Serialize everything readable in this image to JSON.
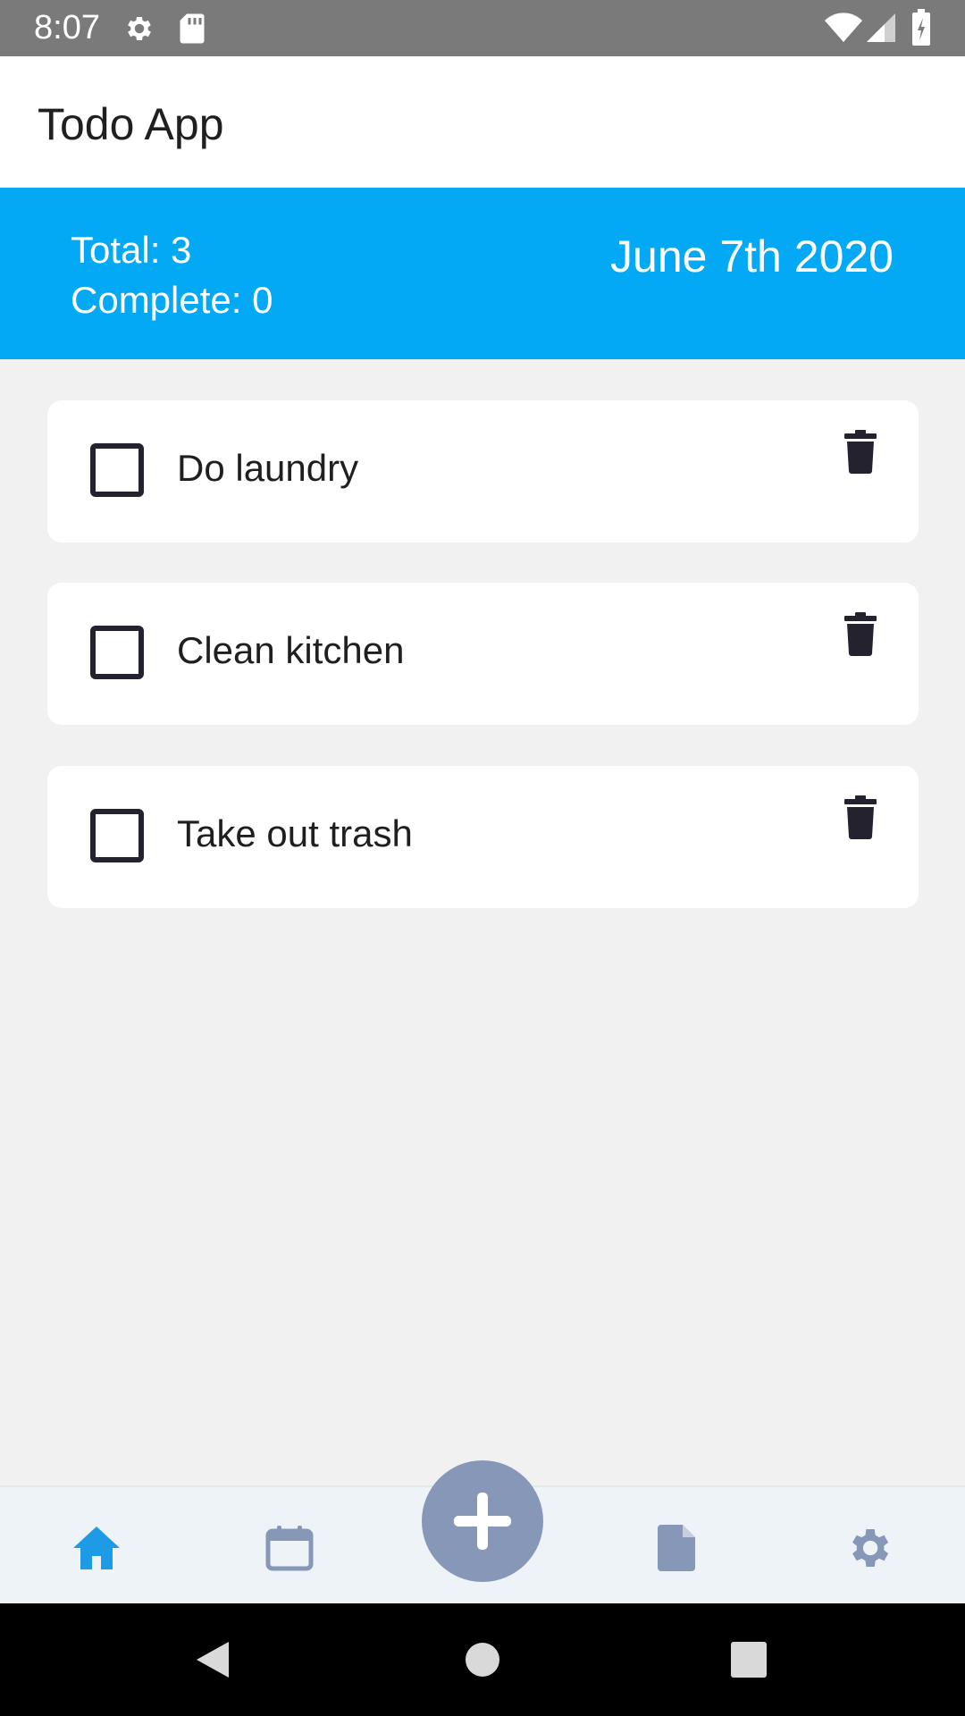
{
  "status_bar": {
    "time": "8:07",
    "icons": [
      "gear-icon",
      "sd-card-icon",
      "wifi-icon",
      "signal-icon",
      "battery-icon"
    ]
  },
  "app_bar": {
    "title": "Todo App"
  },
  "summary": {
    "total_label": "Total: 3",
    "complete_label": "Complete: 0",
    "date": "June 7th 2020",
    "background_color": "#03a9f4"
  },
  "todos": [
    {
      "label": "Do laundry",
      "checked": false
    },
    {
      "label": "Clean kitchen",
      "checked": false
    },
    {
      "label": "Take out trash",
      "checked": false
    }
  ],
  "bottom_nav": {
    "items": [
      {
        "icon": "home-icon",
        "active": true
      },
      {
        "icon": "calendar-icon",
        "active": false
      },
      {
        "icon": "add-icon",
        "active": false
      },
      {
        "icon": "document-icon",
        "active": false
      },
      {
        "icon": "settings-icon",
        "active": false
      }
    ],
    "active_color": "#1e9be6",
    "inactive_color": "#8797b8"
  },
  "system_nav": {
    "icons": [
      "back-icon",
      "home-circle-icon",
      "recents-icon"
    ]
  }
}
